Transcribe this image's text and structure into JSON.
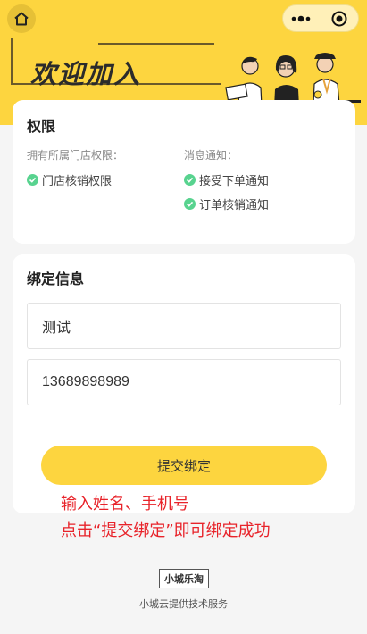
{
  "header": {
    "welcome_text": "欢迎加入",
    "home_icon": "home-icon",
    "more_icon": "more-dots-icon",
    "close_icon": "target-close-icon"
  },
  "permissions": {
    "title": "权限",
    "store_heading": "拥有所属门店权限：",
    "store_items": [
      "门店核销权限"
    ],
    "notify_heading": "消息通知：",
    "notify_items": [
      "接受下单通知",
      "订单核销通知"
    ]
  },
  "binding": {
    "title": "绑定信息",
    "name_value": "测试",
    "phone_value": "13689898989",
    "submit_label": "提交绑定"
  },
  "annotation": {
    "line1": "输入姓名、手机号",
    "line2": "点击“提交绑定”即可绑定成功"
  },
  "footer": {
    "logo_text": "小城乐淘",
    "service_text": "小城云提供技术服务"
  },
  "colors": {
    "brand_yellow": "#fdd53f",
    "check_green": "#58d38f",
    "annotation_red": "#e8232a"
  }
}
